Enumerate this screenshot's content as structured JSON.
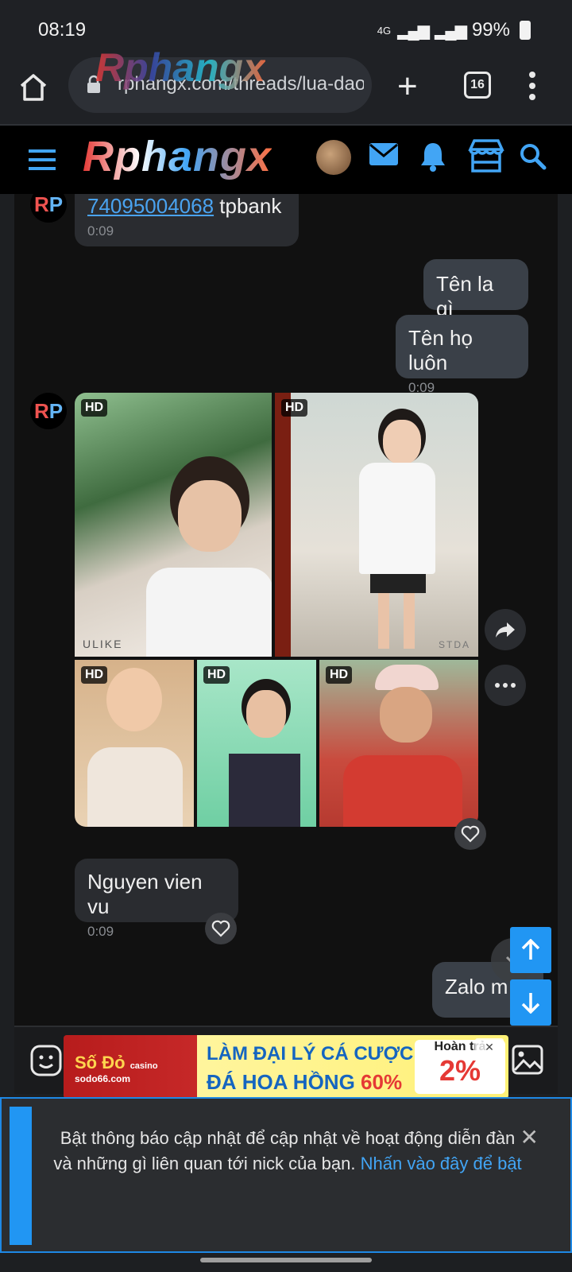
{
  "status": {
    "time": "08:19",
    "network": "4G",
    "battery": "99%"
  },
  "browser": {
    "url": "rphangx.com/threads/lua-dao",
    "tab_count": "16",
    "watermark": "Rphangx"
  },
  "site": {
    "logo": "Rphangx"
  },
  "messages": {
    "m1": {
      "account": "74095004068",
      "bank": " tpbank",
      "time": "0:09"
    },
    "m2": {
      "text": "Tên la gì"
    },
    "m3": {
      "text": "Tên họ luôn",
      "time": "0:09"
    },
    "m4": {
      "text": "Nguyen vien vu",
      "time": "0:09"
    },
    "m5": {
      "text": "Zalo m"
    },
    "avatar": {
      "initial1": "R",
      "initial2": "P"
    },
    "hd_label": "HD",
    "photo_captions": {
      "p1": "ULIKE",
      "p2": "STDA"
    }
  },
  "ad": {
    "brand": "Số Đỏ",
    "brand_tag": "casino",
    "brand_url": "sodo66.com",
    "line1": "LÀM ĐẠI LÝ CÁ CƯỢC BÓNG",
    "line2_a": "ĐÁ HOA HỒNG ",
    "line2_b": "60%",
    "right_top": "Hoàn trả",
    "right_big": "2%"
  },
  "notice": {
    "text": "Bật thông báo cập nhật để cập nhật về hoạt động diễn đàn và những gì liên quan tới nick của bạn. ",
    "link": "Nhấn vào đây để bật",
    "close": "✕"
  }
}
